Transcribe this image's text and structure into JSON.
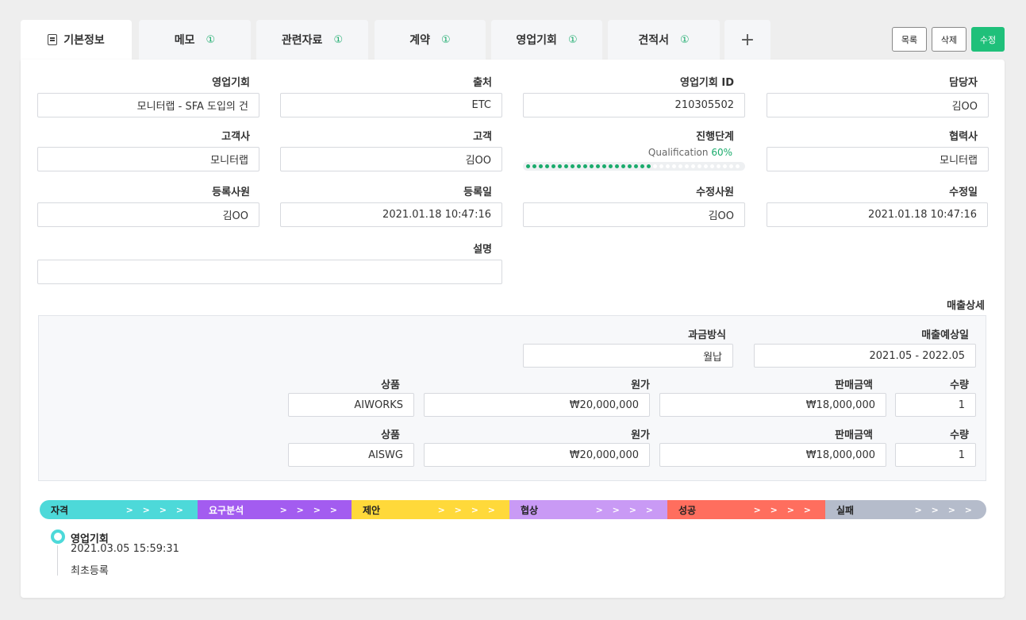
{
  "tabs": [
    {
      "label": "기본정보",
      "badge": ""
    },
    {
      "label": "메모",
      "badge": "①"
    },
    {
      "label": "관련자료",
      "badge": "①"
    },
    {
      "label": "계약",
      "badge": "①"
    },
    {
      "label": "영업기회",
      "badge": "①"
    },
    {
      "label": "견적서",
      "badge": "①"
    },
    {
      "label": "+",
      "badge": ""
    }
  ],
  "actions": {
    "list": "목록",
    "delete": "삭제",
    "edit": "수정"
  },
  "fields": {
    "opportunity": {
      "label": "영업기회",
      "value": "모니터랩 - SFA 도입의 건"
    },
    "source": {
      "label": "출처",
      "value": "ETC"
    },
    "opportunity_id": {
      "label": "영업기회 ID",
      "value": "210305502"
    },
    "owner": {
      "label": "담당자",
      "value": "김OO"
    },
    "company": {
      "label": "고객사",
      "value": "모니터랩"
    },
    "customer": {
      "label": "고객",
      "value": "김OO"
    },
    "stage": {
      "label": "진행단계",
      "name": "Qualification",
      "percent_text": "60%",
      "progress": 0.6
    },
    "partner": {
      "label": "협력사",
      "value": "모니터랩"
    },
    "registrar": {
      "label": "등록사원",
      "value": "김OO"
    },
    "registered_at": {
      "label": "등록일",
      "value": "2021.01.18  10:47:16"
    },
    "modifier": {
      "label": "수정사원",
      "value": "김OO"
    },
    "modified_at": {
      "label": "수정일",
      "value": "2021.01.18  10:47:16"
    },
    "description": {
      "label": "설명",
      "value": ""
    }
  },
  "sales": {
    "title": "매출상세",
    "billing": {
      "label": "과금방식",
      "value": "월납"
    },
    "expected_date": {
      "label": "매출예상일",
      "value": "2021.05 - 2022.05"
    },
    "rows": [
      {
        "product_label": "상품",
        "product": "AIWORKS",
        "cost_label": "원가",
        "cost": "₩20,000,000",
        "price_label": "판매금액",
        "price": "₩18,000,000",
        "qty_label": "수량",
        "qty": "1"
      },
      {
        "product_label": "상품",
        "product": "AISWG",
        "cost_label": "원가",
        "cost": "₩20,000,000",
        "price_label": "판매금액",
        "price": "₩18,000,000",
        "qty_label": "수량",
        "qty": "1"
      }
    ]
  },
  "pipeline": [
    {
      "label": "자격",
      "arrows": "> > > >",
      "color": "#4dd9d9",
      "text_color": "#222222"
    },
    {
      "label": "요구분석",
      "arrows": "> > > >",
      "color": "#a35cf0",
      "text_color": "#ffffff"
    },
    {
      "label": "제안",
      "arrows": "> > > >",
      "color": "#ffd93a",
      "text_color": "#222222"
    },
    {
      "label": "협상",
      "arrows": "> > > >",
      "color": "#c99af5",
      "text_color": "#222222"
    },
    {
      "label": "성공",
      "arrows": "> > > >",
      "color": "#ff6e5e",
      "text_color": "#222222"
    },
    {
      "label": "실패",
      "arrows": "> > > >",
      "color": "#b5bccb",
      "text_color": "#222222"
    }
  ],
  "history": {
    "title": "영업기회",
    "time": "2021.03.05  15:59:31",
    "note": "최초등록"
  },
  "colors": {
    "accent": "#1fc07a",
    "badge": "#1aab6c"
  }
}
